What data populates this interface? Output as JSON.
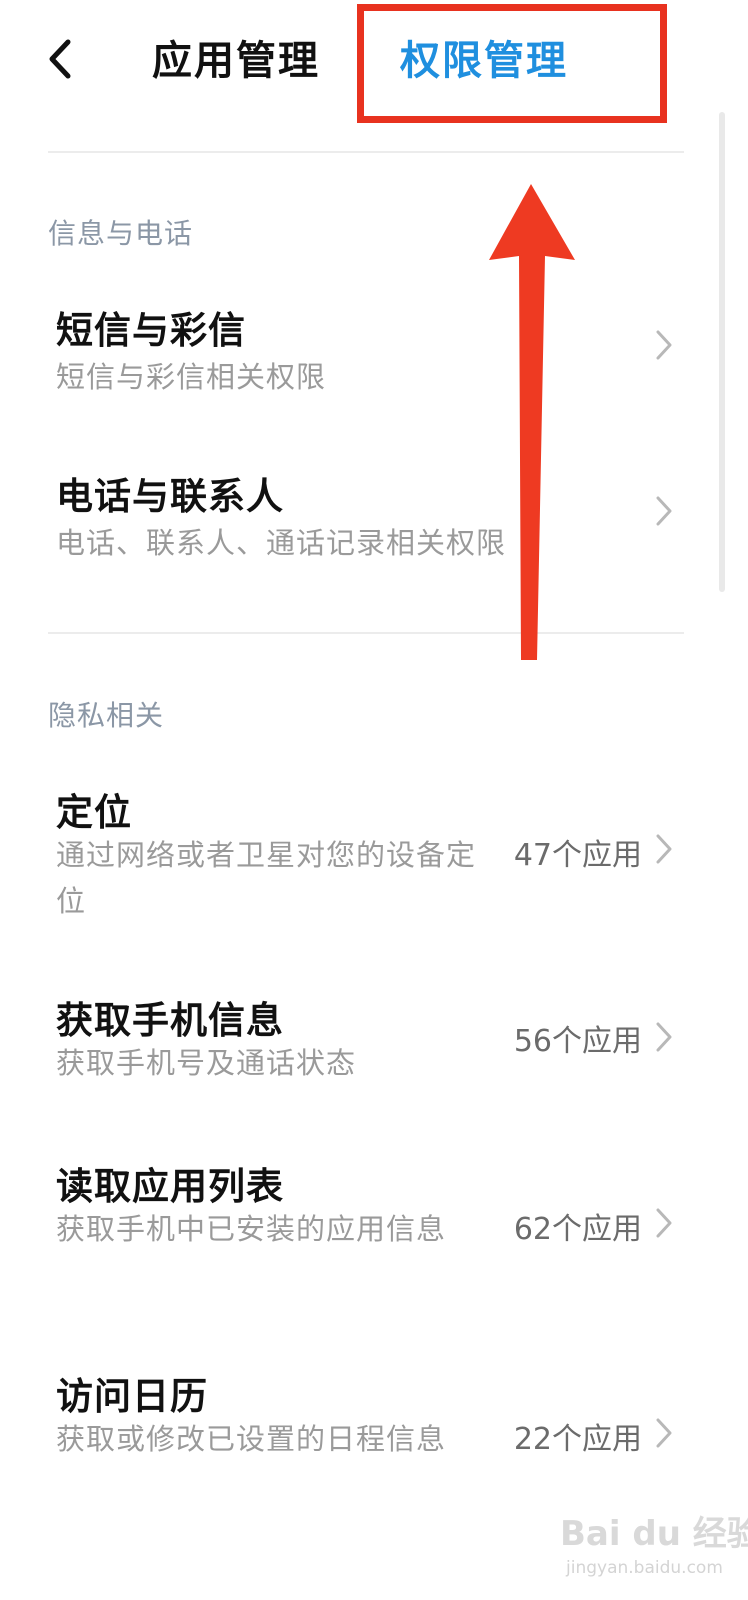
{
  "header": {
    "tab_app_management": "应用管理",
    "tab_permission_management": "权限管理"
  },
  "sections": [
    {
      "title": "信息与电话",
      "items": [
        {
          "title": "短信与彩信",
          "subtitle": "短信与彩信相关权限"
        },
        {
          "title": "电话与联系人",
          "subtitle": "电话、联系人、通话记录相关权限"
        }
      ]
    },
    {
      "title": "隐私相关",
      "items": [
        {
          "title": "定位",
          "subtitle": "通过网络或者卫星对您的设备定位",
          "count": "47个应用"
        },
        {
          "title": "获取手机信息",
          "subtitle": "获取手机号及通话状态",
          "count": "56个应用"
        },
        {
          "title": "读取应用列表",
          "subtitle": "获取手机中已安装的应用信息",
          "count": "62个应用"
        },
        {
          "title": "访问日历",
          "subtitle": "获取或修改已设置的日程信息",
          "count": "22个应用"
        }
      ]
    }
  ],
  "watermark": {
    "brand": "Bai du 经验",
    "url": "jingyan.baidu.com"
  },
  "colors": {
    "accent_blue": "#1f8fdf",
    "highlight_red": "#e8321f",
    "section_title_gray": "#8b97a6"
  },
  "icons": {
    "back": "chevron-left-icon",
    "row_arrow": "chevron-right-icon",
    "annotation": "red-arrow-up-icon"
  }
}
